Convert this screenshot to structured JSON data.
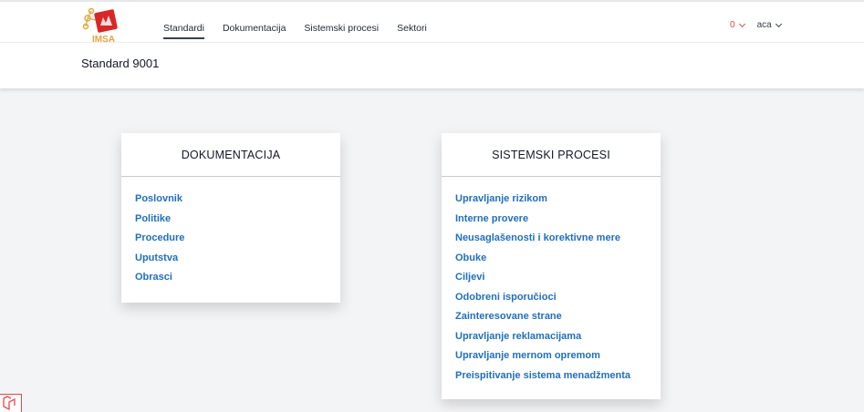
{
  "brand": {
    "logo_text": "IMSA",
    "accent": "#e11d48"
  },
  "nav": {
    "items": [
      {
        "label": "Standardi",
        "active": true
      },
      {
        "label": "Dokumentacija",
        "active": false
      },
      {
        "label": "Sistemski procesi",
        "active": false
      },
      {
        "label": "Sektori",
        "active": false
      }
    ]
  },
  "header_right": {
    "notification_count": "0",
    "username": "aca"
  },
  "page": {
    "title": "Standard 9001"
  },
  "cards": {
    "documentation": {
      "title": "DOKUMENTACIJA",
      "links": [
        "Poslovnik",
        "Politike",
        "Procedure",
        "Uputstva",
        "Obrasci"
      ]
    },
    "processes": {
      "title": "SISTEMSKI PROCESI",
      "links": [
        "Upravljanje rizikom",
        "Interne provere",
        "Neusaglašenosti i korektivne mere",
        "Obuke",
        "Ciljevi",
        "Odobreni isporučioci",
        "Zainteresovane strane",
        "Upravljanje reklamacijama",
        "Upravljanje mernom opremom",
        "Preispitivanje sistema menadžmenta"
      ]
    }
  },
  "colors": {
    "link": "#1d6fc4",
    "notification": "#ef4444",
    "background": "#f3f4f6"
  }
}
